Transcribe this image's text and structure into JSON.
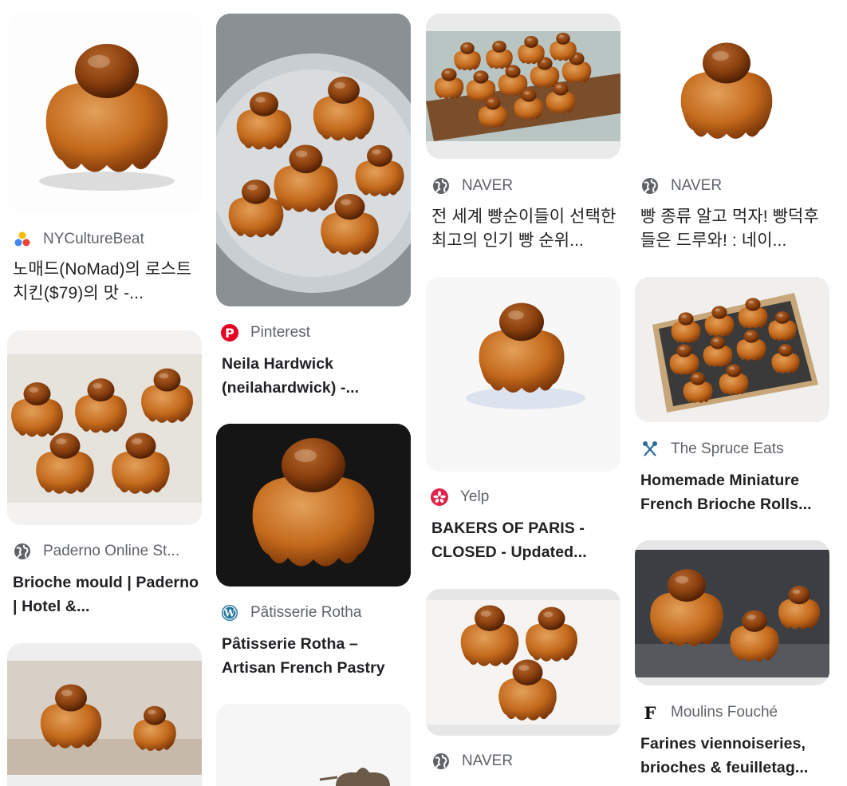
{
  "results": [
    {
      "source": "NYCultureBeat",
      "title": "노매드(NoMad)의 로스트 치킨($79)의 맛 -..."
    },
    {
      "source": "Paderno Online St...",
      "title": "Brioche mould | Paderno | Hotel &..."
    },
    {
      "source": "Pinterest",
      "title": "Neila Hardwick (neilahardwick) -..."
    },
    {
      "source": "Pâtisserie Rotha",
      "title": "Pâtisserie Rotha – Artisan French Pastry"
    },
    {
      "source": "NAVER",
      "title": "전 세계 빵순이들이 선택한 최고의 인기 빵 순위..."
    },
    {
      "source": "Yelp",
      "title": "BAKERS OF PARIS - CLOSED - Updated..."
    },
    {
      "source": "NAVER",
      "title": "..."
    },
    {
      "source": "NAVER",
      "title": "빵 종류 알고 먹자! 빵덕후들은 드루와! : 네이..."
    },
    {
      "source": "The Spruce Eats",
      "title": "Homemade Miniature French Brioche Rolls..."
    },
    {
      "source": "Moulins Fouché",
      "title": "Farines viennoiseries, brioches & feuilletag..."
    }
  ],
  "icons": {
    "nyculturebeat": "nyculturebeat-logo-icon",
    "globe": "globe-icon",
    "pinterest": "pinterest-logo-icon",
    "wordpress": "wordpress-logo-icon",
    "yelp": "yelp-logo-icon",
    "spruce": "spruce-eats-logo-icon",
    "fouche": "moulins-fouche-logo-icon"
  },
  "colors": {
    "brioche": "#c46a1c",
    "brioche_dark": "#8a3f0e",
    "pinterest": "#e60023",
    "yelp": "#d32323",
    "globe": "#5f6368",
    "wordpress": "#21759b",
    "spruce": "#2b6a9a"
  }
}
